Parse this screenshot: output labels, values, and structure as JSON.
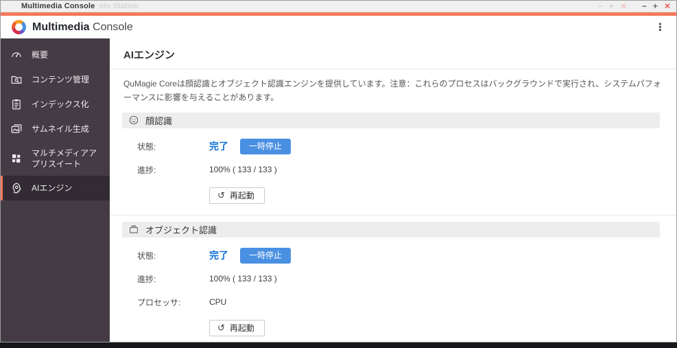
{
  "colors": {
    "accent_orange": "#f4795a",
    "pause_button_blue": "#4a90e2",
    "status_blue": "#0c6fd6",
    "sidebar_bg": "#443b45",
    "sidebar_active_bg": "#322b33",
    "section_header_bg": "#eeedee",
    "close_red": "#e8392e"
  },
  "titlebar": {
    "title": "Multimedia Console",
    "ghost_title": "oto Station",
    "minimize": "−",
    "maximize": "+",
    "close": "✕"
  },
  "header": {
    "brand_bold": "Multimedia",
    "brand_light": "Console",
    "menu_icon": "⋮"
  },
  "sidebar": {
    "items": [
      {
        "label": "概要",
        "icon": "gauge-icon"
      },
      {
        "label": "コンテンツ管理",
        "icon": "folder-search-icon"
      },
      {
        "label": "インデックス化",
        "icon": "clipboard-icon"
      },
      {
        "label": "サムネイル生成",
        "icon": "images-icon"
      },
      {
        "label": "マルチメディアアプリスイート",
        "icon": "grid-icon"
      },
      {
        "label": "AIエンジン",
        "icon": "ai-head-icon"
      }
    ]
  },
  "main": {
    "page_title": "AIエンジン",
    "description": "QuMagie Coreは顔認識とオブジェクト認識エンジンを提供しています。注意：これらのプロセスはバックグラウンドで実行され、システムパフォーマンスに影響を与えることがあります。",
    "sections": [
      {
        "title": "顔認識",
        "status_label": "状態:",
        "status_value": "完了",
        "pause_button": "一時停止",
        "progress_label": "進捗:",
        "progress_value": "100% ( 133 / 133 )",
        "restart_icon": "↺",
        "restart_button": "再起動"
      },
      {
        "title": "オブジェクト認識",
        "status_label": "状態:",
        "status_value": "完了",
        "pause_button": "一時停止",
        "progress_label": "進捗:",
        "progress_value": "100% ( 133 / 133 )",
        "processor_label": "プロセッサ:",
        "processor_value": "CPU",
        "restart_icon": "↺",
        "restart_button": "再起動"
      }
    ]
  }
}
